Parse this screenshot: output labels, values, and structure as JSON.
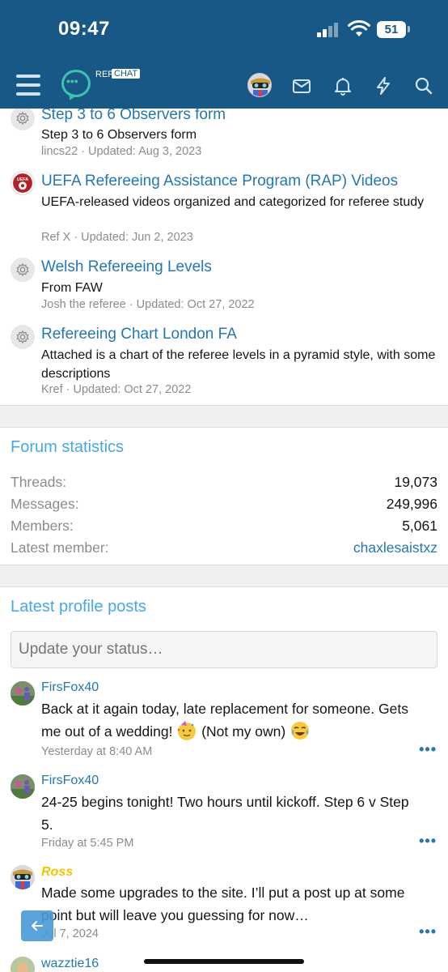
{
  "status_bar": {
    "time": "09:47",
    "battery": "51"
  },
  "header": {
    "logo_ref": "REF",
    "logo_chat": "CHAT"
  },
  "resources": [
    {
      "title": "Step 3 to 6 Observers form",
      "description": "Step 3 to 6 Observers form",
      "meta": "lincs22 · Updated: Aug 3, 2023",
      "icon": "gear-icon"
    },
    {
      "title": "UEFA Refereeing Assistance Program (RAP) Videos",
      "description": "UEFA-released videos organized and categorized for referee study",
      "meta": "Ref X · Updated: Jun 2, 2023",
      "icon": "uefa-logo-icon"
    },
    {
      "title": "Welsh Refereeing Levels",
      "description": "From FAW",
      "meta": "Josh the referee · Updated: Oct 27, 2022",
      "icon": "gear-icon"
    },
    {
      "title": "Refereeing Chart London FA",
      "description": "Attached is a chart of the referee levels in a pyramid style, with some descriptions",
      "meta": "Kref · Updated: Oct 27, 2022",
      "icon": "gear-icon"
    }
  ],
  "forum_stats": {
    "title": "Forum statistics",
    "rows": [
      {
        "label": "Threads:",
        "value": "19,073"
      },
      {
        "label": "Messages:",
        "value": "249,996"
      },
      {
        "label": "Members:",
        "value": "5,061"
      },
      {
        "label": "Latest member:",
        "value": "chaxlesaistxz"
      }
    ]
  },
  "profile_posts": {
    "title": "Latest profile posts",
    "placeholder": "Update your status…",
    "posts": [
      {
        "author": "FirsFox40",
        "text_a": "Back at it again today, late replacement for someone. Gets me out of a wedding! ",
        "text_b": " (Not my own) ",
        "time": "Yesterday at 8:40 AM",
        "more": "•••"
      },
      {
        "author": "FirsFox40",
        "text": "24-25 begins tonight! Two hours until kickoff. Step 6 v Step 5.",
        "time": "Friday at 5:45 PM",
        "more": "•••"
      },
      {
        "author": "Ross",
        "text": "Made some upgrades to the site. I’ll put a post up at some point but will leave you guessing for now…",
        "time": "Jul 7, 2024",
        "more": "•••"
      },
      {
        "author": "wazztie16"
      }
    ]
  }
}
